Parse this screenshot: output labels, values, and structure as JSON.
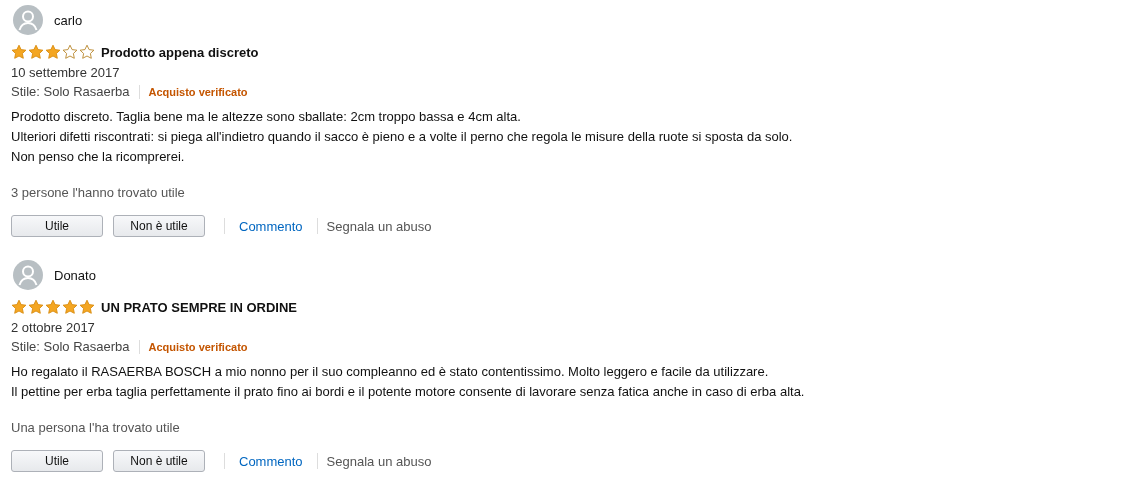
{
  "reviews": [
    {
      "author": "carlo",
      "stars": 3,
      "title": "Prodotto appena discreto",
      "date": "10 settembre 2017",
      "style": "Stile: Solo Rasaerba",
      "badge": "Acquisto verificato",
      "body": [
        "Prodotto discreto. Taglia bene ma le altezze sono sballate: 2cm troppo bassa e 4cm alta.",
        "Ulteriori difetti riscontrati: si piega all'indietro quando il sacco è pieno e a volte il perno che regola le misure della ruote si sposta da solo.",
        "Non penso che la ricomprerei."
      ],
      "helpful": "3 persone l'hanno trovato utile",
      "buttons": [
        "Utile",
        "Non è utile"
      ],
      "comment": "Commento",
      "report": "Segnala un abuso"
    },
    {
      "author": "Donato",
      "stars": 5,
      "title": "UN PRATO SEMPRE IN ORDINE",
      "date": "2 ottobre 2017",
      "style": "Stile: Solo Rasaerba",
      "badge": "Acquisto verificato",
      "body": [
        "Ho regalato il RASAERBA BOSCH a mio nonno per il suo compleanno ed è stato contentissimo. Molto leggero e facile da utilizzare.",
        "Il pettine per erba taglia perfettamente il prato fino ai bordi e il potente motore consente di lavorare senza fatica anche in caso di erba alta."
      ],
      "helpful": "Una persona l'ha trovato utile",
      "buttons": [
        "Utile",
        "Non è utile"
      ],
      "comment": "Commento",
      "report": "Segnala un abuso"
    }
  ]
}
